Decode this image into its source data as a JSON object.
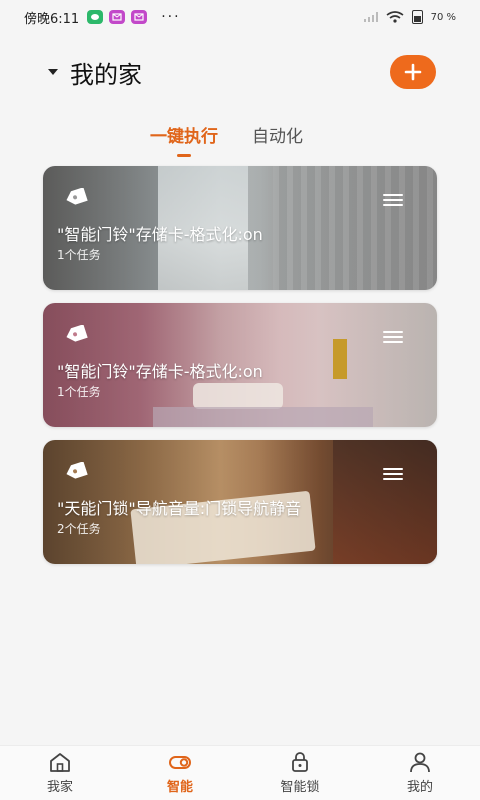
{
  "status_bar": {
    "time": "傍晚6:11",
    "more": "···",
    "battery": "70 %"
  },
  "header": {
    "title": "我的家"
  },
  "tabs": [
    {
      "label": "一键执行",
      "active": true
    },
    {
      "label": "自动化",
      "active": false
    }
  ],
  "scenes": [
    {
      "title": "\"智能门铃\"存储卡-格式化:on",
      "task_count": "1个任务"
    },
    {
      "title": "\"智能门铃\"存储卡-格式化:on",
      "task_count": "1个任务"
    },
    {
      "title": "\"天能门锁\"导航音量:门锁导航静音",
      "task_count": "2个任务"
    }
  ],
  "bottom_nav": [
    {
      "label": "我家",
      "icon": "home-icon"
    },
    {
      "label": "智能",
      "icon": "smart-icon",
      "active": true
    },
    {
      "label": "智能锁",
      "icon": "lock-icon"
    },
    {
      "label": "我的",
      "icon": "user-icon"
    }
  ],
  "colors": {
    "accent": "#e0651a",
    "add_button": "#ee6a1c"
  }
}
